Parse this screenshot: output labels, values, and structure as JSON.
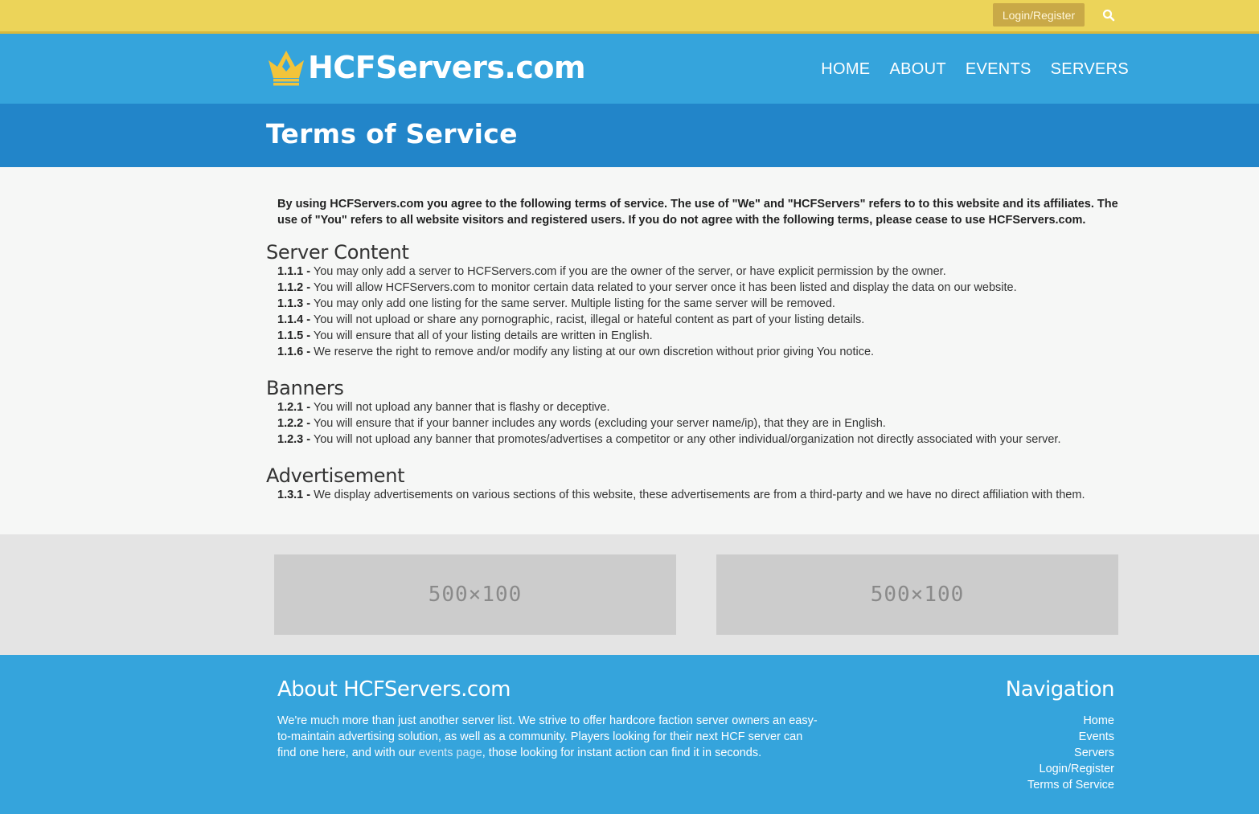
{
  "topbar": {
    "login_label": "Login/Register",
    "search_icon": "search-icon"
  },
  "header": {
    "logo_text": "HCFServers.com",
    "logo_icon": "crown-icon",
    "nav": [
      "HOME",
      "ABOUT",
      "EVENTS",
      "SERVERS"
    ]
  },
  "banner": {
    "title": "Terms of Service"
  },
  "intro": "By using HCFServers.com you agree to the following terms of service. The use of \"We\" and \"HCFServers\" refers to to this website and its affiliates. The use of \"You\" refers to all website visitors and registered users. If you do not agree with the following terms, please cease to use HCFServers.com.",
  "sections": [
    {
      "title": "Server Content",
      "rules": [
        {
          "num": "1.1.1 -",
          "text": " You may only add a server to HCFServers.com if you are the owner of the server, or have explicit permission by the owner."
        },
        {
          "num": "1.1.2 -",
          "text": " You will allow HCFServers.com to monitor certain data related to your server once it has been listed and display the data on our website."
        },
        {
          "num": "1.1.3 -",
          "text": " You may only add one listing for the same server. Multiple listing for the same server will be removed."
        },
        {
          "num": "1.1.4 -",
          "text": " You will not upload or share any pornographic, racist, illegal or hateful content as part of your listing details."
        },
        {
          "num": "1.1.5 -",
          "text": " You will ensure that all of your listing details are written in English."
        },
        {
          "num": "1.1.6 -",
          "text": " We reserve the right to remove and/or modify any listing at our own discretion without prior giving You notice."
        }
      ]
    },
    {
      "title": "Banners",
      "rules": [
        {
          "num": "1.2.1 -",
          "text": " You will not upload any banner that is flashy or deceptive."
        },
        {
          "num": "1.2.2 -",
          "text": " You will ensure that if your banner includes any words (excluding your server name/ip), that they are in English."
        },
        {
          "num": "1.2.3 -",
          "text": " You will not upload any banner that promotes/advertises a competitor or any other individual/organization not directly associated with your server."
        }
      ]
    },
    {
      "title": "Advertisement",
      "rules": [
        {
          "num": "1.3.1 -",
          "text": " We display advertisements on various sections of this website, these advertisements are from a third-party and we have no direct affiliation with them."
        }
      ]
    }
  ],
  "ads": [
    "500×100",
    "500×100"
  ],
  "footer": {
    "about_title": "About HCFServers.com",
    "about_text_1": "We're much more than just another server list. We strive to offer hardcore faction server owners an easy-to-maintain advertising solution, as well as a community. Players looking for their next HCF server can find one here, and with our ",
    "about_link": "events page",
    "about_text_2": ", those looking for instant action can find it in seconds.",
    "nav_title": "Navigation",
    "nav": [
      "Home",
      "Events",
      "Servers",
      "Login/Register",
      "Terms of Service"
    ]
  },
  "colors": {
    "topbar": "#ecd459",
    "header": "#35a4dc",
    "banner": "#2285c9",
    "login_button": "#c9a947"
  }
}
